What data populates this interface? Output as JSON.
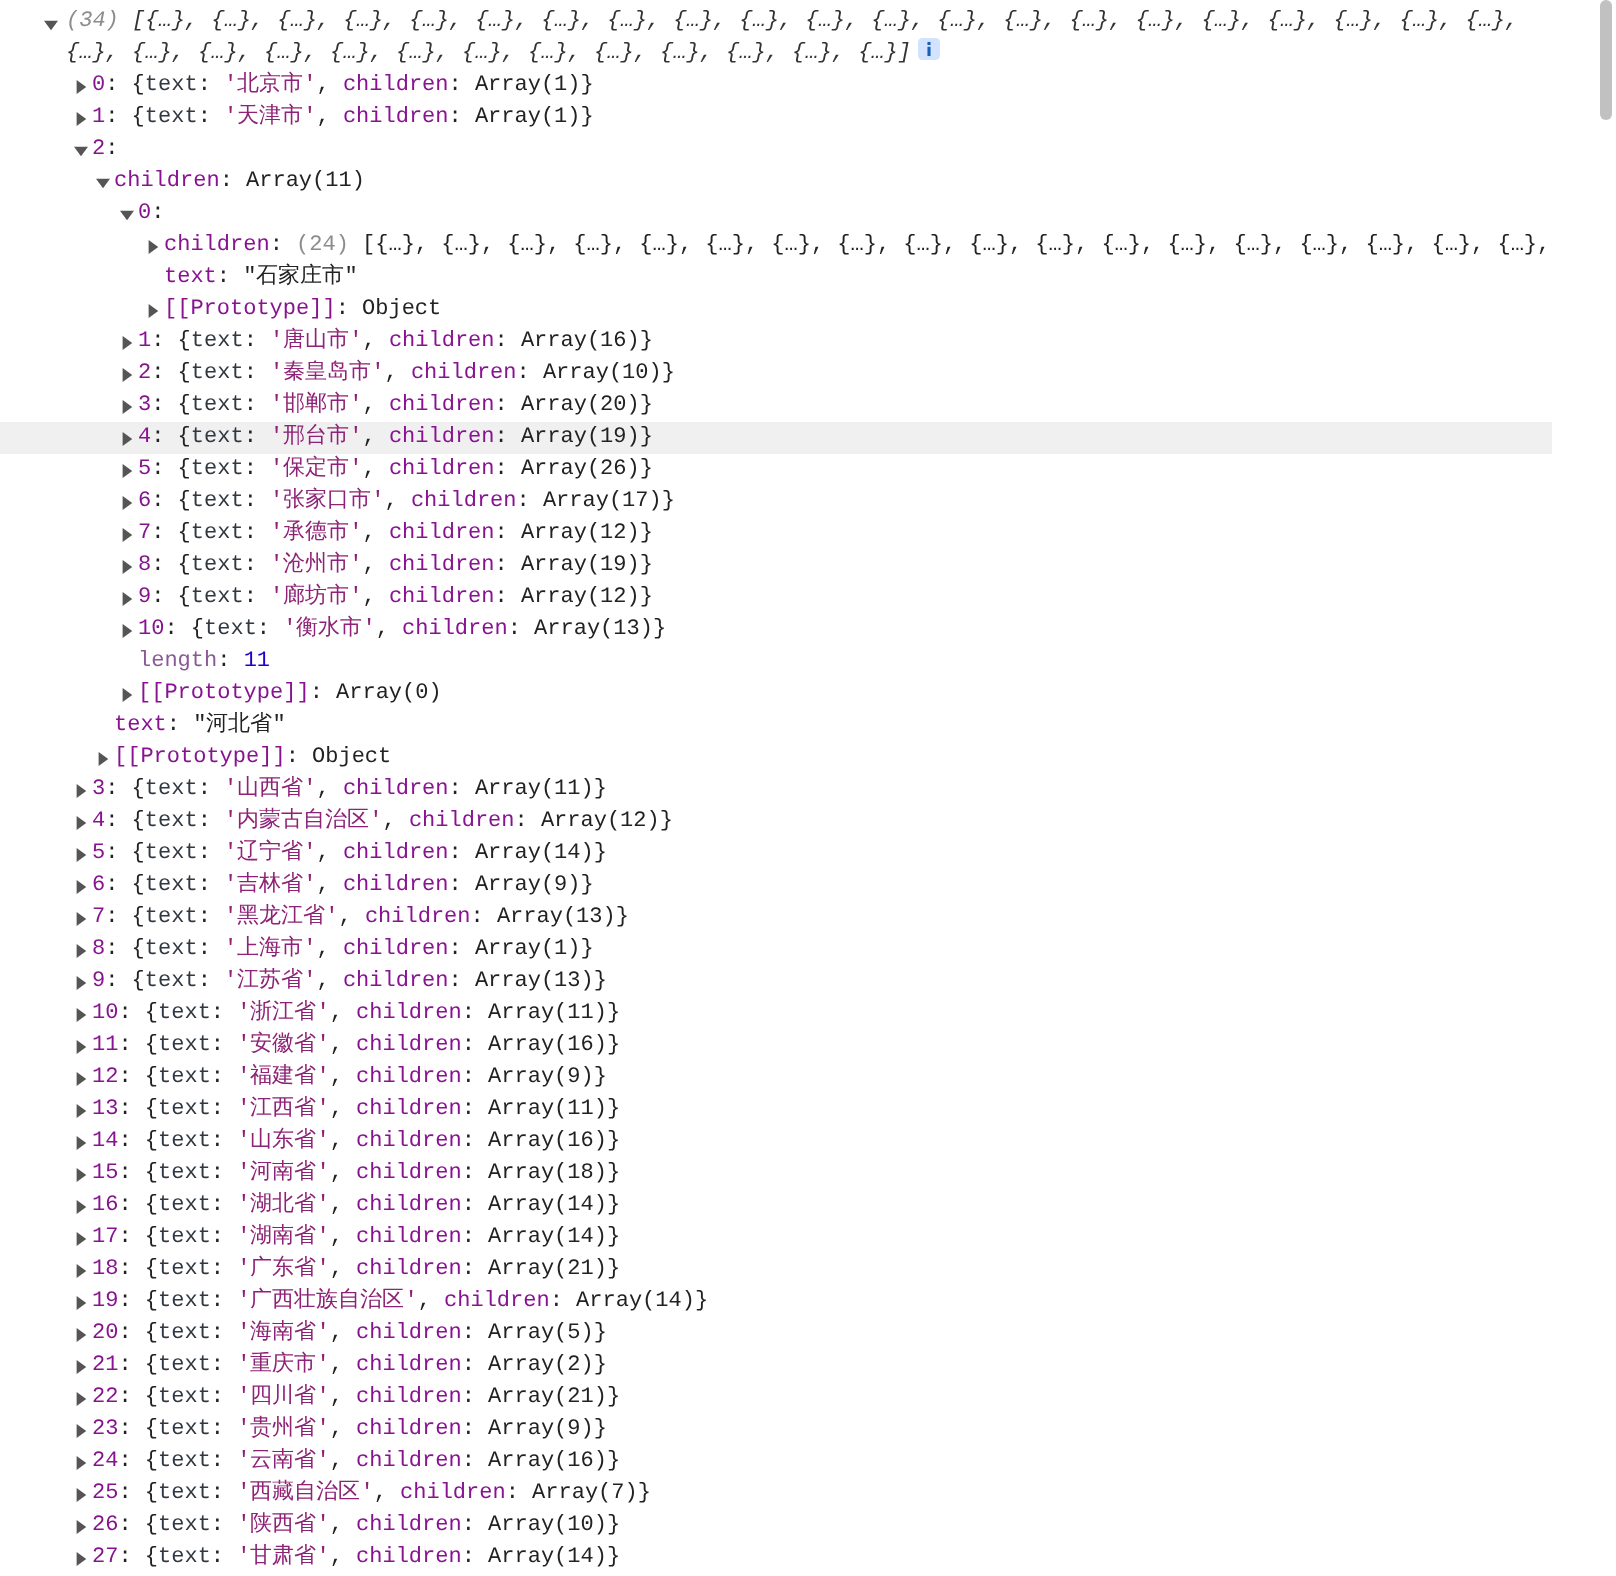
{
  "tree": [
    {
      "expanded": true,
      "info": true,
      "parts": [
        {
          "kind": "count",
          "text": "(34) "
        },
        {
          "kind": "preview",
          "text": "[{…}, {…}, {…}, {…}, {…}, {…}, {…}, {…}, {…}, {…}, {…}, {…}, {…}, {…}, {…}, {…}, {…}, {…}, {…}, {…}, {…}, {…}, {…}, {…}, {…}, {…}, {…}, {…}, {…}, {…}, {…}, {…}, {…}, {…}]"
        }
      ],
      "children": [
        {
          "expanded": false,
          "parts": [
            {
              "kind": "key",
              "text": "0"
            },
            {
              "kind": "plain",
              "text": ": {"
            },
            {
              "kind": "name",
              "text": "text"
            },
            {
              "kind": "plain",
              "text": ": "
            },
            {
              "kind": "string",
              "text": "'北京市'"
            },
            {
              "kind": "plain",
              "text": ", "
            },
            {
              "kind": "key",
              "text": "children"
            },
            {
              "kind": "plain",
              "text": ": Array(1)}"
            }
          ]
        },
        {
          "expanded": false,
          "parts": [
            {
              "kind": "key",
              "text": "1"
            },
            {
              "kind": "plain",
              "text": ": {"
            },
            {
              "kind": "name",
              "text": "text"
            },
            {
              "kind": "plain",
              "text": ": "
            },
            {
              "kind": "string",
              "text": "'天津市'"
            },
            {
              "kind": "plain",
              "text": ", "
            },
            {
              "kind": "key",
              "text": "children"
            },
            {
              "kind": "plain",
              "text": ": Array(1)}"
            }
          ]
        },
        {
          "expanded": true,
          "parts": [
            {
              "kind": "key",
              "text": "2"
            },
            {
              "kind": "plain",
              "text": ":"
            }
          ],
          "children": [
            {
              "expanded": true,
              "parts": [
                {
                  "kind": "key",
                  "text": "children"
                },
                {
                  "kind": "plain",
                  "text": ": Array(11)"
                }
              ],
              "children": [
                {
                  "expanded": true,
                  "hovered": false,
                  "parts": [
                    {
                      "kind": "key",
                      "text": "0"
                    },
                    {
                      "kind": "plain",
                      "text": ":"
                    }
                  ],
                  "children": [
                    {
                      "expanded": false,
                      "parts": [
                        {
                          "kind": "key",
                          "text": "children"
                        },
                        {
                          "kind": "plain",
                          "text": ": "
                        },
                        {
                          "kind": "count",
                          "text": "(24) "
                        },
                        {
                          "kind": "plain",
                          "text": "[{…}, {…}, {…}, {…}, {…}, {…}, {…}, {…}, {…}, {…}, {…}, {…}, {…}, {…}, {…}, {…}, {…}, {…},"
                        }
                      ]
                    },
                    {
                      "parts": [
                        {
                          "kind": "key",
                          "text": "text"
                        },
                        {
                          "kind": "plain",
                          "text": ": \"石家庄市\""
                        }
                      ]
                    },
                    {
                      "expanded": false,
                      "parts": [
                        {
                          "kind": "key",
                          "text": "[[Prototype]]"
                        },
                        {
                          "kind": "plain",
                          "text": ": Object"
                        }
                      ]
                    }
                  ]
                },
                {
                  "expanded": false,
                  "hovered": false,
                  "parts": [
                    {
                      "kind": "key",
                      "text": "1"
                    },
                    {
                      "kind": "plain",
                      "text": ": {"
                    },
                    {
                      "kind": "name",
                      "text": "text"
                    },
                    {
                      "kind": "plain",
                      "text": ": "
                    },
                    {
                      "kind": "string",
                      "text": "'唐山市'"
                    },
                    {
                      "kind": "plain",
                      "text": ", "
                    },
                    {
                      "kind": "key",
                      "text": "children"
                    },
                    {
                      "kind": "plain",
                      "text": ": Array(16)}"
                    }
                  ]
                },
                {
                  "expanded": false,
                  "hovered": false,
                  "parts": [
                    {
                      "kind": "key",
                      "text": "2"
                    },
                    {
                      "kind": "plain",
                      "text": ": {"
                    },
                    {
                      "kind": "name",
                      "text": "text"
                    },
                    {
                      "kind": "plain",
                      "text": ": "
                    },
                    {
                      "kind": "string",
                      "text": "'秦皇岛市'"
                    },
                    {
                      "kind": "plain",
                      "text": ", "
                    },
                    {
                      "kind": "key",
                      "text": "children"
                    },
                    {
                      "kind": "plain",
                      "text": ": Array(10)}"
                    }
                  ]
                },
                {
                  "expanded": false,
                  "hovered": false,
                  "parts": [
                    {
                      "kind": "key",
                      "text": "3"
                    },
                    {
                      "kind": "plain",
                      "text": ": {"
                    },
                    {
                      "kind": "name",
                      "text": "text"
                    },
                    {
                      "kind": "plain",
                      "text": ": "
                    },
                    {
                      "kind": "string",
                      "text": "'邯郸市'"
                    },
                    {
                      "kind": "plain",
                      "text": ", "
                    },
                    {
                      "kind": "key",
                      "text": "children"
                    },
                    {
                      "kind": "plain",
                      "text": ": Array(20)}"
                    }
                  ]
                },
                {
                  "expanded": false,
                  "hovered": true,
                  "parts": [
                    {
                      "kind": "key",
                      "text": "4"
                    },
                    {
                      "kind": "plain",
                      "text": ": {"
                    },
                    {
                      "kind": "name",
                      "text": "text"
                    },
                    {
                      "kind": "plain",
                      "text": ": "
                    },
                    {
                      "kind": "string",
                      "text": "'邢台市'"
                    },
                    {
                      "kind": "plain",
                      "text": ", "
                    },
                    {
                      "kind": "key",
                      "text": "children"
                    },
                    {
                      "kind": "plain",
                      "text": ": Array(19)}"
                    }
                  ]
                },
                {
                  "expanded": false,
                  "hovered": false,
                  "parts": [
                    {
                      "kind": "key",
                      "text": "5"
                    },
                    {
                      "kind": "plain",
                      "text": ": {"
                    },
                    {
                      "kind": "name",
                      "text": "text"
                    },
                    {
                      "kind": "plain",
                      "text": ": "
                    },
                    {
                      "kind": "string",
                      "text": "'保定市'"
                    },
                    {
                      "kind": "plain",
                      "text": ", "
                    },
                    {
                      "kind": "key",
                      "text": "children"
                    },
                    {
                      "kind": "plain",
                      "text": ": Array(26)}"
                    }
                  ]
                },
                {
                  "expanded": false,
                  "hovered": false,
                  "parts": [
                    {
                      "kind": "key",
                      "text": "6"
                    },
                    {
                      "kind": "plain",
                      "text": ": {"
                    },
                    {
                      "kind": "name",
                      "text": "text"
                    },
                    {
                      "kind": "plain",
                      "text": ": "
                    },
                    {
                      "kind": "string",
                      "text": "'张家口市'"
                    },
                    {
                      "kind": "plain",
                      "text": ", "
                    },
                    {
                      "kind": "key",
                      "text": "children"
                    },
                    {
                      "kind": "plain",
                      "text": ": Array(17)}"
                    }
                  ]
                },
                {
                  "expanded": false,
                  "hovered": false,
                  "parts": [
                    {
                      "kind": "key",
                      "text": "7"
                    },
                    {
                      "kind": "plain",
                      "text": ": {"
                    },
                    {
                      "kind": "name",
                      "text": "text"
                    },
                    {
                      "kind": "plain",
                      "text": ": "
                    },
                    {
                      "kind": "string",
                      "text": "'承德市'"
                    },
                    {
                      "kind": "plain",
                      "text": ", "
                    },
                    {
                      "kind": "key",
                      "text": "children"
                    },
                    {
                      "kind": "plain",
                      "text": ": Array(12)}"
                    }
                  ]
                },
                {
                  "expanded": false,
                  "hovered": false,
                  "parts": [
                    {
                      "kind": "key",
                      "text": "8"
                    },
                    {
                      "kind": "plain",
                      "text": ": {"
                    },
                    {
                      "kind": "name",
                      "text": "text"
                    },
                    {
                      "kind": "plain",
                      "text": ": "
                    },
                    {
                      "kind": "string",
                      "text": "'沧州市'"
                    },
                    {
                      "kind": "plain",
                      "text": ", "
                    },
                    {
                      "kind": "key",
                      "text": "children"
                    },
                    {
                      "kind": "plain",
                      "text": ": Array(19)}"
                    }
                  ]
                },
                {
                  "expanded": false,
                  "hovered": false,
                  "parts": [
                    {
                      "kind": "key",
                      "text": "9"
                    },
                    {
                      "kind": "plain",
                      "text": ": {"
                    },
                    {
                      "kind": "name",
                      "text": "text"
                    },
                    {
                      "kind": "plain",
                      "text": ": "
                    },
                    {
                      "kind": "string",
                      "text": "'廊坊市'"
                    },
                    {
                      "kind": "plain",
                      "text": ", "
                    },
                    {
                      "kind": "key",
                      "text": "children"
                    },
                    {
                      "kind": "plain",
                      "text": ": Array(12)}"
                    }
                  ]
                },
                {
                  "expanded": false,
                  "hovered": false,
                  "parts": [
                    {
                      "kind": "key",
                      "text": "10"
                    },
                    {
                      "kind": "plain",
                      "text": ": {"
                    },
                    {
                      "kind": "name",
                      "text": "text"
                    },
                    {
                      "kind": "plain",
                      "text": ": "
                    },
                    {
                      "kind": "string",
                      "text": "'衡水市'"
                    },
                    {
                      "kind": "plain",
                      "text": ", "
                    },
                    {
                      "kind": "key",
                      "text": "children"
                    },
                    {
                      "kind": "plain",
                      "text": ": Array(13)}"
                    }
                  ]
                },
                {
                  "hovered": false,
                  "parts": [
                    {
                      "kind": "dimkey",
                      "text": "length"
                    },
                    {
                      "kind": "plain",
                      "text": ": "
                    },
                    {
                      "kind": "number",
                      "text": "11"
                    }
                  ]
                },
                {
                  "expanded": false,
                  "hovered": false,
                  "parts": [
                    {
                      "kind": "key",
                      "text": "[[Prototype]]"
                    },
                    {
                      "kind": "plain",
                      "text": ": Array(0)"
                    }
                  ]
                }
              ]
            },
            {
              "parts": [
                {
                  "kind": "key",
                  "text": "text"
                },
                {
                  "kind": "plain",
                  "text": ": \"河北省\""
                }
              ]
            },
            {
              "expanded": false,
              "parts": [
                {
                  "kind": "key",
                  "text": "[[Prototype]]"
                },
                {
                  "kind": "plain",
                  "text": ": Object"
                }
              ]
            }
          ]
        },
        {
          "expanded": false,
          "parts": [
            {
              "kind": "key",
              "text": "3"
            },
            {
              "kind": "plain",
              "text": ": {"
            },
            {
              "kind": "name",
              "text": "text"
            },
            {
              "kind": "plain",
              "text": ": "
            },
            {
              "kind": "string",
              "text": "'山西省'"
            },
            {
              "kind": "plain",
              "text": ", "
            },
            {
              "kind": "key",
              "text": "children"
            },
            {
              "kind": "plain",
              "text": ": Array(11)}"
            }
          ]
        },
        {
          "expanded": false,
          "parts": [
            {
              "kind": "key",
              "text": "4"
            },
            {
              "kind": "plain",
              "text": ": {"
            },
            {
              "kind": "name",
              "text": "text"
            },
            {
              "kind": "plain",
              "text": ": "
            },
            {
              "kind": "string",
              "text": "'内蒙古自治区'"
            },
            {
              "kind": "plain",
              "text": ", "
            },
            {
              "kind": "key",
              "text": "children"
            },
            {
              "kind": "plain",
              "text": ": Array(12)}"
            }
          ]
        },
        {
          "expanded": false,
          "parts": [
            {
              "kind": "key",
              "text": "5"
            },
            {
              "kind": "plain",
              "text": ": {"
            },
            {
              "kind": "name",
              "text": "text"
            },
            {
              "kind": "plain",
              "text": ": "
            },
            {
              "kind": "string",
              "text": "'辽宁省'"
            },
            {
              "kind": "plain",
              "text": ", "
            },
            {
              "kind": "key",
              "text": "children"
            },
            {
              "kind": "plain",
              "text": ": Array(14)}"
            }
          ]
        },
        {
          "expanded": false,
          "parts": [
            {
              "kind": "key",
              "text": "6"
            },
            {
              "kind": "plain",
              "text": ": {"
            },
            {
              "kind": "name",
              "text": "text"
            },
            {
              "kind": "plain",
              "text": ": "
            },
            {
              "kind": "string",
              "text": "'吉林省'"
            },
            {
              "kind": "plain",
              "text": ", "
            },
            {
              "kind": "key",
              "text": "children"
            },
            {
              "kind": "plain",
              "text": ": Array(9)}"
            }
          ]
        },
        {
          "expanded": false,
          "parts": [
            {
              "kind": "key",
              "text": "7"
            },
            {
              "kind": "plain",
              "text": ": {"
            },
            {
              "kind": "name",
              "text": "text"
            },
            {
              "kind": "plain",
              "text": ": "
            },
            {
              "kind": "string",
              "text": "'黑龙江省'"
            },
            {
              "kind": "plain",
              "text": ", "
            },
            {
              "kind": "key",
              "text": "children"
            },
            {
              "kind": "plain",
              "text": ": Array(13)}"
            }
          ]
        },
        {
          "expanded": false,
          "parts": [
            {
              "kind": "key",
              "text": "8"
            },
            {
              "kind": "plain",
              "text": ": {"
            },
            {
              "kind": "name",
              "text": "text"
            },
            {
              "kind": "plain",
              "text": ": "
            },
            {
              "kind": "string",
              "text": "'上海市'"
            },
            {
              "kind": "plain",
              "text": ", "
            },
            {
              "kind": "key",
              "text": "children"
            },
            {
              "kind": "plain",
              "text": ": Array(1)}"
            }
          ]
        },
        {
          "expanded": false,
          "parts": [
            {
              "kind": "key",
              "text": "9"
            },
            {
              "kind": "plain",
              "text": ": {"
            },
            {
              "kind": "name",
              "text": "text"
            },
            {
              "kind": "plain",
              "text": ": "
            },
            {
              "kind": "string",
              "text": "'江苏省'"
            },
            {
              "kind": "plain",
              "text": ", "
            },
            {
              "kind": "key",
              "text": "children"
            },
            {
              "kind": "plain",
              "text": ": Array(13)}"
            }
          ]
        },
        {
          "expanded": false,
          "parts": [
            {
              "kind": "key",
              "text": "10"
            },
            {
              "kind": "plain",
              "text": ": {"
            },
            {
              "kind": "name",
              "text": "text"
            },
            {
              "kind": "plain",
              "text": ": "
            },
            {
              "kind": "string",
              "text": "'浙江省'"
            },
            {
              "kind": "plain",
              "text": ", "
            },
            {
              "kind": "key",
              "text": "children"
            },
            {
              "kind": "plain",
              "text": ": Array(11)}"
            }
          ]
        },
        {
          "expanded": false,
          "parts": [
            {
              "kind": "key",
              "text": "11"
            },
            {
              "kind": "plain",
              "text": ": {"
            },
            {
              "kind": "name",
              "text": "text"
            },
            {
              "kind": "plain",
              "text": ": "
            },
            {
              "kind": "string",
              "text": "'安徽省'"
            },
            {
              "kind": "plain",
              "text": ", "
            },
            {
              "kind": "key",
              "text": "children"
            },
            {
              "kind": "plain",
              "text": ": Array(16)}"
            }
          ]
        },
        {
          "expanded": false,
          "parts": [
            {
              "kind": "key",
              "text": "12"
            },
            {
              "kind": "plain",
              "text": ": {"
            },
            {
              "kind": "name",
              "text": "text"
            },
            {
              "kind": "plain",
              "text": ": "
            },
            {
              "kind": "string",
              "text": "'福建省'"
            },
            {
              "kind": "plain",
              "text": ", "
            },
            {
              "kind": "key",
              "text": "children"
            },
            {
              "kind": "plain",
              "text": ": Array(9)}"
            }
          ]
        },
        {
          "expanded": false,
          "parts": [
            {
              "kind": "key",
              "text": "13"
            },
            {
              "kind": "plain",
              "text": ": {"
            },
            {
              "kind": "name",
              "text": "text"
            },
            {
              "kind": "plain",
              "text": ": "
            },
            {
              "kind": "string",
              "text": "'江西省'"
            },
            {
              "kind": "plain",
              "text": ", "
            },
            {
              "kind": "key",
              "text": "children"
            },
            {
              "kind": "plain",
              "text": ": Array(11)}"
            }
          ]
        },
        {
          "expanded": false,
          "parts": [
            {
              "kind": "key",
              "text": "14"
            },
            {
              "kind": "plain",
              "text": ": {"
            },
            {
              "kind": "name",
              "text": "text"
            },
            {
              "kind": "plain",
              "text": ": "
            },
            {
              "kind": "string",
              "text": "'山东省'"
            },
            {
              "kind": "plain",
              "text": ", "
            },
            {
              "kind": "key",
              "text": "children"
            },
            {
              "kind": "plain",
              "text": ": Array(16)}"
            }
          ]
        },
        {
          "expanded": false,
          "parts": [
            {
              "kind": "key",
              "text": "15"
            },
            {
              "kind": "plain",
              "text": ": {"
            },
            {
              "kind": "name",
              "text": "text"
            },
            {
              "kind": "plain",
              "text": ": "
            },
            {
              "kind": "string",
              "text": "'河南省'"
            },
            {
              "kind": "plain",
              "text": ", "
            },
            {
              "kind": "key",
              "text": "children"
            },
            {
              "kind": "plain",
              "text": ": Array(18)}"
            }
          ]
        },
        {
          "expanded": false,
          "parts": [
            {
              "kind": "key",
              "text": "16"
            },
            {
              "kind": "plain",
              "text": ": {"
            },
            {
              "kind": "name",
              "text": "text"
            },
            {
              "kind": "plain",
              "text": ": "
            },
            {
              "kind": "string",
              "text": "'湖北省'"
            },
            {
              "kind": "plain",
              "text": ", "
            },
            {
              "kind": "key",
              "text": "children"
            },
            {
              "kind": "plain",
              "text": ": Array(14)}"
            }
          ]
        },
        {
          "expanded": false,
          "parts": [
            {
              "kind": "key",
              "text": "17"
            },
            {
              "kind": "plain",
              "text": ": {"
            },
            {
              "kind": "name",
              "text": "text"
            },
            {
              "kind": "plain",
              "text": ": "
            },
            {
              "kind": "string",
              "text": "'湖南省'"
            },
            {
              "kind": "plain",
              "text": ", "
            },
            {
              "kind": "key",
              "text": "children"
            },
            {
              "kind": "plain",
              "text": ": Array(14)}"
            }
          ]
        },
        {
          "expanded": false,
          "parts": [
            {
              "kind": "key",
              "text": "18"
            },
            {
              "kind": "plain",
              "text": ": {"
            },
            {
              "kind": "name",
              "text": "text"
            },
            {
              "kind": "plain",
              "text": ": "
            },
            {
              "kind": "string",
              "text": "'广东省'"
            },
            {
              "kind": "plain",
              "text": ", "
            },
            {
              "kind": "key",
              "text": "children"
            },
            {
              "kind": "plain",
              "text": ": Array(21)}"
            }
          ]
        },
        {
          "expanded": false,
          "parts": [
            {
              "kind": "key",
              "text": "19"
            },
            {
              "kind": "plain",
              "text": ": {"
            },
            {
              "kind": "name",
              "text": "text"
            },
            {
              "kind": "plain",
              "text": ": "
            },
            {
              "kind": "string",
              "text": "'广西壮族自治区'"
            },
            {
              "kind": "plain",
              "text": ", "
            },
            {
              "kind": "key",
              "text": "children"
            },
            {
              "kind": "plain",
              "text": ": Array(14)}"
            }
          ]
        },
        {
          "expanded": false,
          "parts": [
            {
              "kind": "key",
              "text": "20"
            },
            {
              "kind": "plain",
              "text": ": {"
            },
            {
              "kind": "name",
              "text": "text"
            },
            {
              "kind": "plain",
              "text": ": "
            },
            {
              "kind": "string",
              "text": "'海南省'"
            },
            {
              "kind": "plain",
              "text": ", "
            },
            {
              "kind": "key",
              "text": "children"
            },
            {
              "kind": "plain",
              "text": ": Array(5)}"
            }
          ]
        },
        {
          "expanded": false,
          "parts": [
            {
              "kind": "key",
              "text": "21"
            },
            {
              "kind": "plain",
              "text": ": {"
            },
            {
              "kind": "name",
              "text": "text"
            },
            {
              "kind": "plain",
              "text": ": "
            },
            {
              "kind": "string",
              "text": "'重庆市'"
            },
            {
              "kind": "plain",
              "text": ", "
            },
            {
              "kind": "key",
              "text": "children"
            },
            {
              "kind": "plain",
              "text": ": Array(2)}"
            }
          ]
        },
        {
          "expanded": false,
          "parts": [
            {
              "kind": "key",
              "text": "22"
            },
            {
              "kind": "plain",
              "text": ": {"
            },
            {
              "kind": "name",
              "text": "text"
            },
            {
              "kind": "plain",
              "text": ": "
            },
            {
              "kind": "string",
              "text": "'四川省'"
            },
            {
              "kind": "plain",
              "text": ", "
            },
            {
              "kind": "key",
              "text": "children"
            },
            {
              "kind": "plain",
              "text": ": Array(21)}"
            }
          ]
        },
        {
          "expanded": false,
          "parts": [
            {
              "kind": "key",
              "text": "23"
            },
            {
              "kind": "plain",
              "text": ": {"
            },
            {
              "kind": "name",
              "text": "text"
            },
            {
              "kind": "plain",
              "text": ": "
            },
            {
              "kind": "string",
              "text": "'贵州省'"
            },
            {
              "kind": "plain",
              "text": ", "
            },
            {
              "kind": "key",
              "text": "children"
            },
            {
              "kind": "plain",
              "text": ": Array(9)}"
            }
          ]
        },
        {
          "expanded": false,
          "parts": [
            {
              "kind": "key",
              "text": "24"
            },
            {
              "kind": "plain",
              "text": ": {"
            },
            {
              "kind": "name",
              "text": "text"
            },
            {
              "kind": "plain",
              "text": ": "
            },
            {
              "kind": "string",
              "text": "'云南省'"
            },
            {
              "kind": "plain",
              "text": ", "
            },
            {
              "kind": "key",
              "text": "children"
            },
            {
              "kind": "plain",
              "text": ": Array(16)}"
            }
          ]
        },
        {
          "expanded": false,
          "parts": [
            {
              "kind": "key",
              "text": "25"
            },
            {
              "kind": "plain",
              "text": ": {"
            },
            {
              "kind": "name",
              "text": "text"
            },
            {
              "kind": "plain",
              "text": ": "
            },
            {
              "kind": "string",
              "text": "'西藏自治区'"
            },
            {
              "kind": "plain",
              "text": ", "
            },
            {
              "kind": "key",
              "text": "children"
            },
            {
              "kind": "plain",
              "text": ": Array(7)}"
            }
          ]
        },
        {
          "expanded": false,
          "parts": [
            {
              "kind": "key",
              "text": "26"
            },
            {
              "kind": "plain",
              "text": ": {"
            },
            {
              "kind": "name",
              "text": "text"
            },
            {
              "kind": "plain",
              "text": ": "
            },
            {
              "kind": "string",
              "text": "'陕西省'"
            },
            {
              "kind": "plain",
              "text": ", "
            },
            {
              "kind": "key",
              "text": "children"
            },
            {
              "kind": "plain",
              "text": ": Array(10)}"
            }
          ]
        },
        {
          "expanded": false,
          "parts": [
            {
              "kind": "key",
              "text": "27"
            },
            {
              "kind": "plain",
              "text": ": {"
            },
            {
              "kind": "name",
              "text": "text"
            },
            {
              "kind": "plain",
              "text": ": "
            },
            {
              "kind": "string",
              "text": "'甘肃省'"
            },
            {
              "kind": "plain",
              "text": ", "
            },
            {
              "kind": "key",
              "text": "children"
            },
            {
              "kind": "plain",
              "text": ": Array(14)}"
            }
          ]
        }
      ]
    }
  ]
}
